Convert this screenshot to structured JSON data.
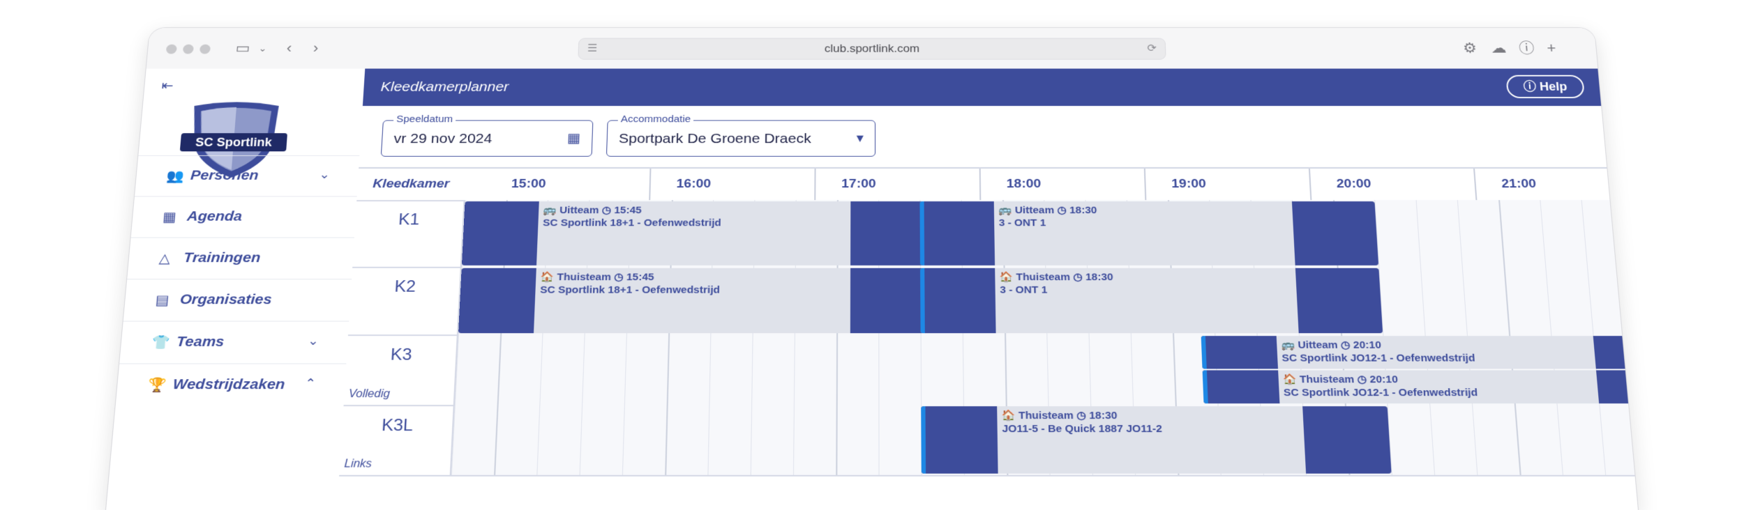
{
  "browser": {
    "url": "club.sportlink.com"
  },
  "sidebar": {
    "logo_text": "SC Sportlink",
    "items": [
      {
        "label": "Personen",
        "icon": "people-icon",
        "expand": "chevron-down"
      },
      {
        "label": "Agenda",
        "icon": "calendar-icon",
        "expand": ""
      },
      {
        "label": "Trainingen",
        "icon": "training-icon",
        "expand": ""
      },
      {
        "label": "Organisaties",
        "icon": "organisation-icon",
        "expand": ""
      },
      {
        "label": "Teams",
        "icon": "shirt-icon",
        "expand": "chevron-down"
      },
      {
        "label": "Wedstrijdzaken",
        "icon": "trophy-icon",
        "expand": "chevron-up"
      }
    ]
  },
  "header": {
    "title": "Kleedkamerplanner",
    "help_label": "Help"
  },
  "filters": {
    "date_legend": "Speeldatum",
    "date_value": "vr 29 nov 2024",
    "acc_legend": "Accommodatie",
    "acc_value": "Sportpark De Groene Draeck"
  },
  "planner": {
    "room_header": "Kleedkamer",
    "times": [
      "15:00",
      "16:00",
      "17:00",
      "18:00",
      "19:00",
      "20:00",
      "21:00"
    ],
    "rooms": [
      {
        "name": "K1",
        "sub": ""
      },
      {
        "name": "K2",
        "sub": ""
      },
      {
        "name": "K3",
        "sub": "Volledig"
      },
      {
        "name": "K3L",
        "sub": "Links"
      }
    ],
    "bookings": [
      {
        "room": 0,
        "start": "14:45",
        "end": "17:35",
        "team": "Uitteam",
        "time": "15:45",
        "match": "SC Sportlink 18+1 - Oefenwedstrijd",
        "accent": false,
        "team_icon": "bus-icon"
      },
      {
        "room": 0,
        "start": "17:30",
        "end": "20:15",
        "team": "Uitteam",
        "time": "18:30",
        "match": "3 - ONT 1",
        "accent": true,
        "team_icon": "bus-icon"
      },
      {
        "room": 1,
        "start": "14:45",
        "end": "17:35",
        "team": "Thuisteam",
        "time": "15:45",
        "match": "SC Sportlink 18+1 - Oefenwedstrijd",
        "accent": false,
        "team_icon": "home-icon"
      },
      {
        "room": 1,
        "start": "17:30",
        "end": "20:15",
        "team": "Thuisteam",
        "time": "18:30",
        "match": "3 - ONT 1",
        "accent": true,
        "team_icon": "home-icon"
      },
      {
        "room": 2,
        "start": "19:10",
        "end": "22:00",
        "team": "Uitteam",
        "time": "20:10",
        "match": "SC Sportlink JO12-1 - Oefenwedstrijd",
        "accent": true,
        "team_icon": "bus-icon"
      },
      {
        "room": 2,
        "start": "19:10",
        "end": "22:00",
        "team": "Thuisteam",
        "time": "20:10",
        "match": "SC Sportlink JO12-1 - Oefenwedstrijd",
        "accent": true,
        "team_icon": "home-icon"
      },
      {
        "room": 3,
        "start": "17:30",
        "end": "20:15",
        "team": "Thuisteam",
        "time": "18:30",
        "match": "JO11-5 - Be Quick 1887 JO11-2",
        "accent": true,
        "team_icon": "home-icon"
      }
    ]
  },
  "colors": {
    "brand": "#3d4c9b",
    "accent": "#1e88e5",
    "block": "#dfe2ea"
  }
}
